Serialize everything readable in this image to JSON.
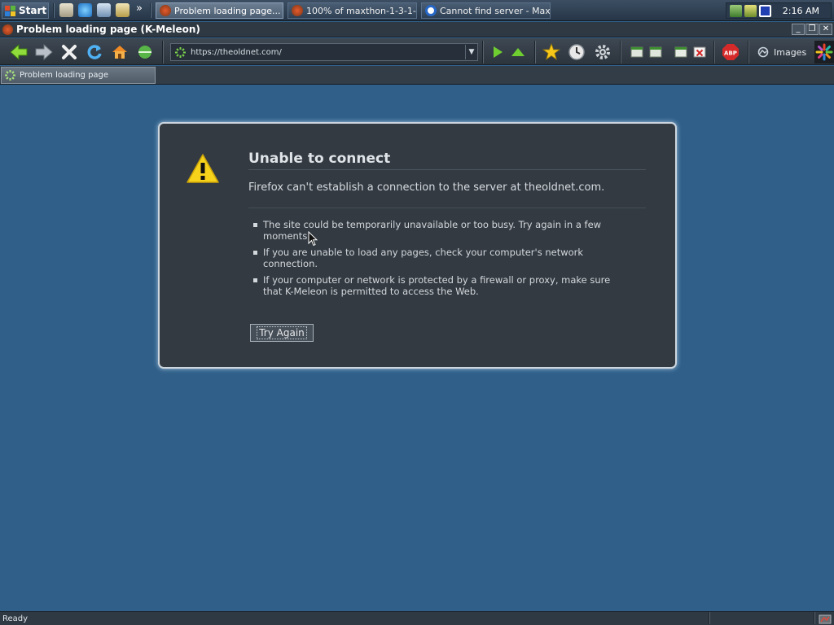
{
  "taskbar": {
    "start_label": "Start",
    "overflow_label": "»",
    "windows": [
      {
        "label": "Problem loading page..."
      },
      {
        "label": "100% of maxthon-1-3-1-..."
      },
      {
        "label": "Cannot find server - Maxt..."
      }
    ],
    "clock": "2:16 AM"
  },
  "window": {
    "title": "Problem loading page (K-Meleon)",
    "minimize": "_",
    "restore": "❐",
    "close": "✕"
  },
  "toolbar": {
    "url": "https://theoldnet.com/",
    "images_label": "Images"
  },
  "tabs": [
    {
      "label": "Problem loading page"
    }
  ],
  "error": {
    "title": "Unable to connect",
    "description": "Firefox can't establish a connection to the server at theoldnet.com.",
    "reasons": [
      "The site could be temporarily unavailable or too busy. Try again in a few moments.",
      "If you are unable to load any pages, check your computer's network connection.",
      "If your computer or network is protected by a firewall or proxy, make sure that K-Meleon is permitted to access the Web."
    ],
    "retry_label": "Try Again"
  },
  "status": {
    "text": "Ready"
  },
  "colors": {
    "page_background": "#30608a",
    "card_background": "#333a41",
    "warning_yellow": "#f7d21a"
  }
}
